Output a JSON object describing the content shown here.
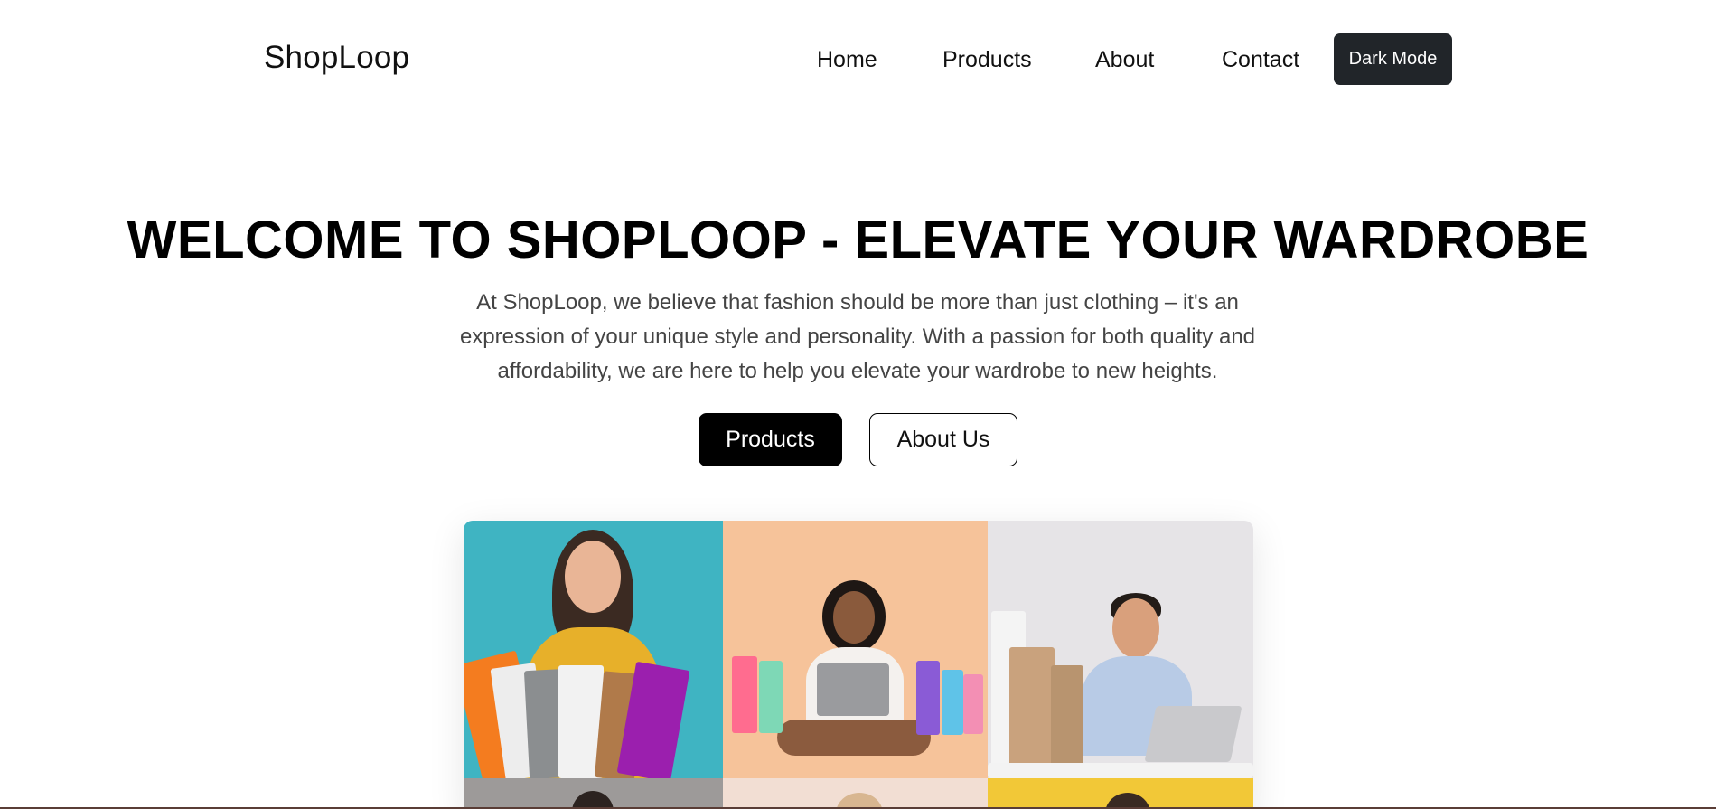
{
  "navbar": {
    "brand": "ShopLoop",
    "links": [
      "Home",
      "Products",
      "About",
      "Contact"
    ],
    "dark_mode_label": "Dark Mode"
  },
  "hero": {
    "title": "WELCOME TO SHOPLOOP - ELEVATE YOUR WARDROBE",
    "text": "At ShopLoop, we believe that fashion should be more than just clothing – it's an expression of your unique style and personality. With a passion for both quality and affordability, we are here to help you elevate your wardrobe to new heights.",
    "primary_button": "Products",
    "secondary_button": "About Us"
  },
  "gallery": {
    "tiles": [
      {
        "subject": "woman-with-shopping-bags",
        "bg": "#3fb4c2"
      },
      {
        "subject": "woman-with-laptop-and-card",
        "bg": "#f6c39a"
      },
      {
        "subject": "man-with-laptop-and-bags",
        "bg": "#e6e4e7"
      },
      {
        "subject": "person-partial",
        "bg": "#9d9a99"
      },
      {
        "subject": "person-partial",
        "bg": "#f2ded3"
      },
      {
        "subject": "person-partial",
        "bg": "#f2c837"
      }
    ]
  },
  "colors": {
    "dark_button": "#212529",
    "primary_button": "#000000"
  }
}
